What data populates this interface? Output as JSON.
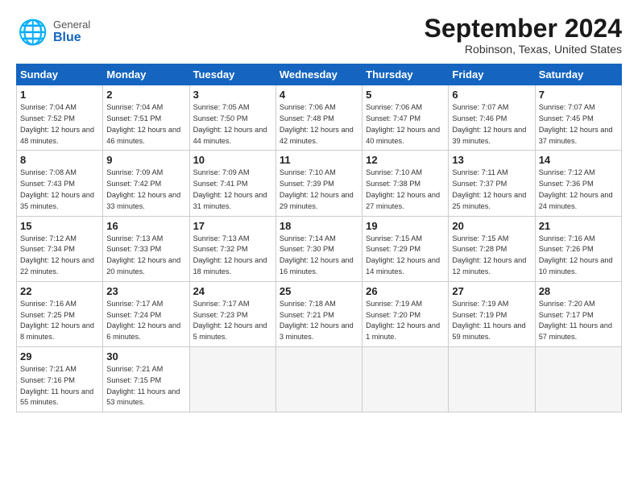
{
  "header": {
    "logo_general": "General",
    "logo_blue": "Blue",
    "month_title": "September 2024",
    "location": "Robinson, Texas, United States"
  },
  "weekdays": [
    "Sunday",
    "Monday",
    "Tuesday",
    "Wednesday",
    "Thursday",
    "Friday",
    "Saturday"
  ],
  "weeks": [
    [
      {
        "day": "1",
        "sunrise": "Sunrise: 7:04 AM",
        "sunset": "Sunset: 7:52 PM",
        "daylight": "Daylight: 12 hours and 48 minutes."
      },
      {
        "day": "2",
        "sunrise": "Sunrise: 7:04 AM",
        "sunset": "Sunset: 7:51 PM",
        "daylight": "Daylight: 12 hours and 46 minutes."
      },
      {
        "day": "3",
        "sunrise": "Sunrise: 7:05 AM",
        "sunset": "Sunset: 7:50 PM",
        "daylight": "Daylight: 12 hours and 44 minutes."
      },
      {
        "day": "4",
        "sunrise": "Sunrise: 7:06 AM",
        "sunset": "Sunset: 7:48 PM",
        "daylight": "Daylight: 12 hours and 42 minutes."
      },
      {
        "day": "5",
        "sunrise": "Sunrise: 7:06 AM",
        "sunset": "Sunset: 7:47 PM",
        "daylight": "Daylight: 12 hours and 40 minutes."
      },
      {
        "day": "6",
        "sunrise": "Sunrise: 7:07 AM",
        "sunset": "Sunset: 7:46 PM",
        "daylight": "Daylight: 12 hours and 39 minutes."
      },
      {
        "day": "7",
        "sunrise": "Sunrise: 7:07 AM",
        "sunset": "Sunset: 7:45 PM",
        "daylight": "Daylight: 12 hours and 37 minutes."
      }
    ],
    [
      {
        "day": "8",
        "sunrise": "Sunrise: 7:08 AM",
        "sunset": "Sunset: 7:43 PM",
        "daylight": "Daylight: 12 hours and 35 minutes."
      },
      {
        "day": "9",
        "sunrise": "Sunrise: 7:09 AM",
        "sunset": "Sunset: 7:42 PM",
        "daylight": "Daylight: 12 hours and 33 minutes."
      },
      {
        "day": "10",
        "sunrise": "Sunrise: 7:09 AM",
        "sunset": "Sunset: 7:41 PM",
        "daylight": "Daylight: 12 hours and 31 minutes."
      },
      {
        "day": "11",
        "sunrise": "Sunrise: 7:10 AM",
        "sunset": "Sunset: 7:39 PM",
        "daylight": "Daylight: 12 hours and 29 minutes."
      },
      {
        "day": "12",
        "sunrise": "Sunrise: 7:10 AM",
        "sunset": "Sunset: 7:38 PM",
        "daylight": "Daylight: 12 hours and 27 minutes."
      },
      {
        "day": "13",
        "sunrise": "Sunrise: 7:11 AM",
        "sunset": "Sunset: 7:37 PM",
        "daylight": "Daylight: 12 hours and 25 minutes."
      },
      {
        "day": "14",
        "sunrise": "Sunrise: 7:12 AM",
        "sunset": "Sunset: 7:36 PM",
        "daylight": "Daylight: 12 hours and 24 minutes."
      }
    ],
    [
      {
        "day": "15",
        "sunrise": "Sunrise: 7:12 AM",
        "sunset": "Sunset: 7:34 PM",
        "daylight": "Daylight: 12 hours and 22 minutes."
      },
      {
        "day": "16",
        "sunrise": "Sunrise: 7:13 AM",
        "sunset": "Sunset: 7:33 PM",
        "daylight": "Daylight: 12 hours and 20 minutes."
      },
      {
        "day": "17",
        "sunrise": "Sunrise: 7:13 AM",
        "sunset": "Sunset: 7:32 PM",
        "daylight": "Daylight: 12 hours and 18 minutes."
      },
      {
        "day": "18",
        "sunrise": "Sunrise: 7:14 AM",
        "sunset": "Sunset: 7:30 PM",
        "daylight": "Daylight: 12 hours and 16 minutes."
      },
      {
        "day": "19",
        "sunrise": "Sunrise: 7:15 AM",
        "sunset": "Sunset: 7:29 PM",
        "daylight": "Daylight: 12 hours and 14 minutes."
      },
      {
        "day": "20",
        "sunrise": "Sunrise: 7:15 AM",
        "sunset": "Sunset: 7:28 PM",
        "daylight": "Daylight: 12 hours and 12 minutes."
      },
      {
        "day": "21",
        "sunrise": "Sunrise: 7:16 AM",
        "sunset": "Sunset: 7:26 PM",
        "daylight": "Daylight: 12 hours and 10 minutes."
      }
    ],
    [
      {
        "day": "22",
        "sunrise": "Sunrise: 7:16 AM",
        "sunset": "Sunset: 7:25 PM",
        "daylight": "Daylight: 12 hours and 8 minutes."
      },
      {
        "day": "23",
        "sunrise": "Sunrise: 7:17 AM",
        "sunset": "Sunset: 7:24 PM",
        "daylight": "Daylight: 12 hours and 6 minutes."
      },
      {
        "day": "24",
        "sunrise": "Sunrise: 7:17 AM",
        "sunset": "Sunset: 7:23 PM",
        "daylight": "Daylight: 12 hours and 5 minutes."
      },
      {
        "day": "25",
        "sunrise": "Sunrise: 7:18 AM",
        "sunset": "Sunset: 7:21 PM",
        "daylight": "Daylight: 12 hours and 3 minutes."
      },
      {
        "day": "26",
        "sunrise": "Sunrise: 7:19 AM",
        "sunset": "Sunset: 7:20 PM",
        "daylight": "Daylight: 12 hours and 1 minute."
      },
      {
        "day": "27",
        "sunrise": "Sunrise: 7:19 AM",
        "sunset": "Sunset: 7:19 PM",
        "daylight": "Daylight: 11 hours and 59 minutes."
      },
      {
        "day": "28",
        "sunrise": "Sunrise: 7:20 AM",
        "sunset": "Sunset: 7:17 PM",
        "daylight": "Daylight: 11 hours and 57 minutes."
      }
    ],
    [
      {
        "day": "29",
        "sunrise": "Sunrise: 7:21 AM",
        "sunset": "Sunset: 7:16 PM",
        "daylight": "Daylight: 11 hours and 55 minutes."
      },
      {
        "day": "30",
        "sunrise": "Sunrise: 7:21 AM",
        "sunset": "Sunset: 7:15 PM",
        "daylight": "Daylight: 11 hours and 53 minutes."
      },
      null,
      null,
      null,
      null,
      null
    ]
  ]
}
